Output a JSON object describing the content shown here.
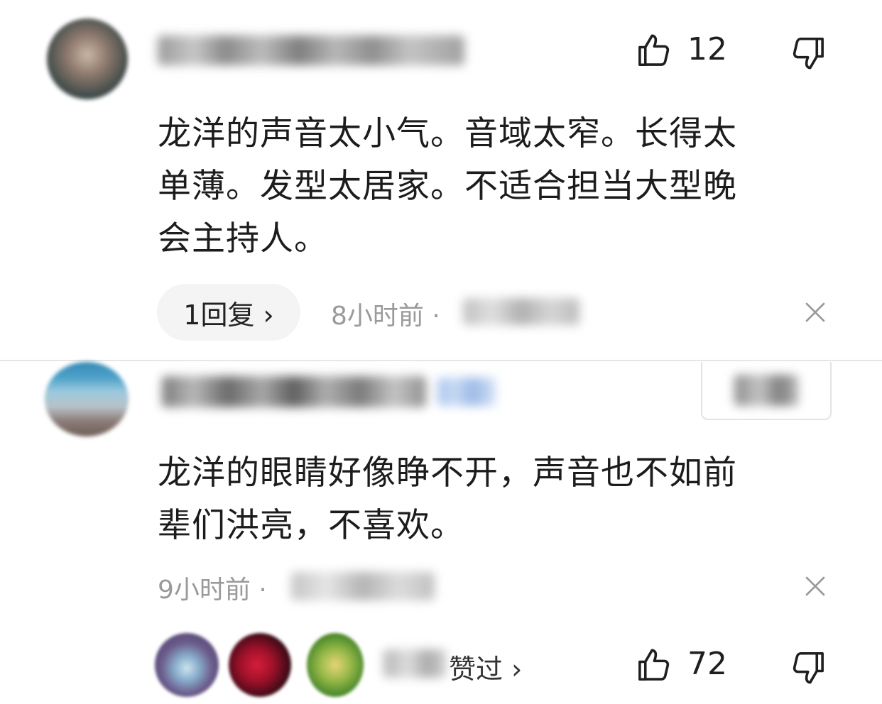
{
  "comments": [
    {
      "likes": "12",
      "text_lines": [
        "龙洋的声音太小气。音域太窄。长得太",
        "单薄。发型太居家。不适合担当大型晚",
        "会主持人。"
      ],
      "reply_button": "1回复 ›",
      "time": "8小时前 ·"
    },
    {
      "text_lines": [
        "龙洋的眼睛好像睁不开，声音也不如前",
        "辈们洪亮，不喜欢。"
      ],
      "time": "9小时前 ·",
      "liked_by_label": "赞过 ›",
      "likes": "72"
    }
  ],
  "colors": {
    "background": "#ffffff",
    "text": "#1c1c1c",
    "meta": "#9a9a9a",
    "reply_pill": "#f4f4f4",
    "divider": "#e6e6e6"
  },
  "icons": [
    "thumb-up-icon",
    "thumb-down-icon",
    "close-icon"
  ]
}
